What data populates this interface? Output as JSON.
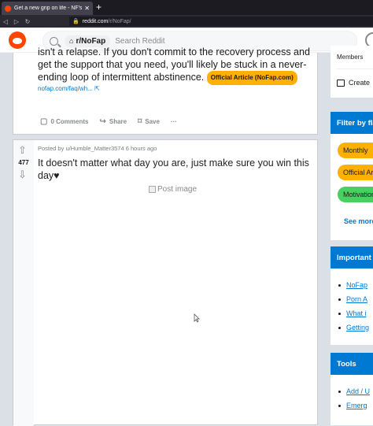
{
  "browser": {
    "tab_title": "Get a new grip on life - NF's offic",
    "tab_close": "✕",
    "new_tab": "+",
    "url_host": "reddit.com",
    "url_path": "/r/NoFap/"
  },
  "header": {
    "subreddit_chip": "r/NoFap",
    "search_placeholder": "Search Reddit"
  },
  "post1": {
    "text": "isn't a relapse. If you don't commit to the recovery process and get the support that you need, you'll likely be stuck in a never-ending loop of intermittent abstinence.",
    "flair": "Official Article (NoFap.com)",
    "link": "nofap.com/faq/wh...",
    "comments_label": "0 Comments",
    "share_label": "Share",
    "save_label": "Save",
    "more_label": "···"
  },
  "post2": {
    "score": "477",
    "meta": "Posted by u/Humble_Matter3574 6 hours ago",
    "title": "It doesn't matter what day you are, just make sure you win this day♥",
    "image_alt": "Post image"
  },
  "sidebar": {
    "members_label": "Members",
    "create_label": "Create",
    "filter_title": "Filter by flair",
    "flairs": [
      {
        "label": "Monthly",
        "color": "#ffb000"
      },
      {
        "label": "Official Article",
        "color": "#ffb000"
      },
      {
        "label": "Motivation",
        "color": "#46d160"
      }
    ],
    "see_more": "See more",
    "important_title": "Important",
    "important_links": [
      "NoFap",
      "Porn A",
      "What i",
      "Getting"
    ],
    "tools_title": "Tools",
    "tools_links": [
      "Add / U",
      "Emerg"
    ]
  }
}
